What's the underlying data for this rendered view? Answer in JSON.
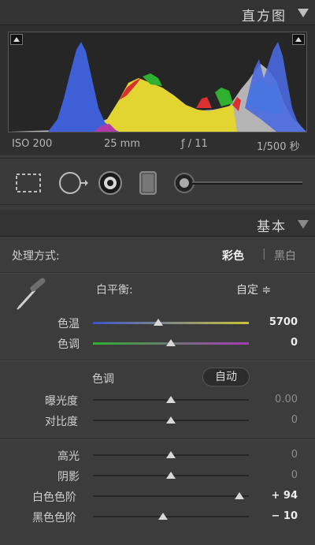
{
  "histogram": {
    "title": "直方图",
    "exif": {
      "iso": "ISO 200",
      "focal": "25 mm",
      "aperture": "ƒ / 11",
      "shutter": "1/500 秒"
    }
  },
  "tools": [
    "crop-overlay",
    "spot-removal",
    "red-eye",
    "graduated-filter",
    "adjustment-brush"
  ],
  "basic": {
    "title": "基本",
    "treatment_label": "处理方式:",
    "treatment_color": "彩色",
    "treatment_separator": "|",
    "treatment_bw": "黑白",
    "wb_label": "白平衡:",
    "wb_value": "自定 ≑",
    "temp_label": "色温",
    "temp_value": "5700",
    "tint_label": "色调",
    "tint_value": "0",
    "tone_label": "色调",
    "auto_label": "自动",
    "exposure_label": "曝光度",
    "exposure_value": "0.00",
    "contrast_label": "对比度",
    "contrast_value": "0",
    "highlights_label": "高光",
    "highlights_value": "0",
    "shadows_label": "阴影",
    "shadows_value": "0",
    "whites_label": "白色色阶",
    "whites_value": "+ 94",
    "blacks_label": "黑色色阶",
    "blacks_value": "− 10"
  },
  "sliders": {
    "temp": 0.42,
    "tint": 0.5,
    "exposure": 0.5,
    "contrast": 0.5,
    "highlights": 0.5,
    "shadows": 0.5,
    "whites": 0.94,
    "blacks": 0.45
  },
  "colors": {
    "histogram_blue": "#3f5fd6",
    "histogram_yellow": "#e2d431",
    "histogram_green": "#2fb02f",
    "histogram_red": "#d93030",
    "histogram_cyan": "#33d6e0",
    "histogram_gray": "#b4b4b4"
  }
}
